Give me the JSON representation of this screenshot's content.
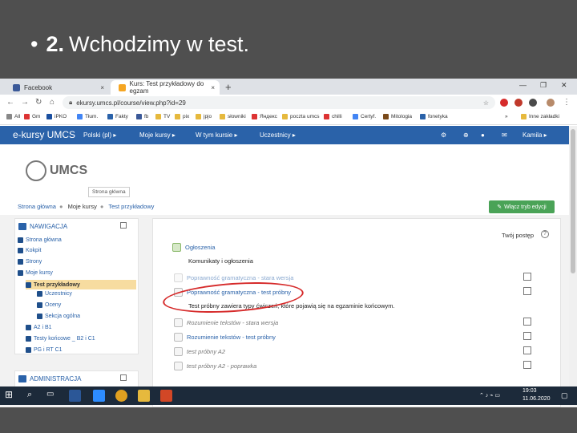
{
  "slide": {
    "bullet": "•",
    "number": "2.",
    "title": "Wchodzimy w test."
  },
  "browser": {
    "tabs": [
      {
        "label": "Facebook",
        "favicon_color": "#3b5998"
      },
      {
        "label": "Kurs: Test przykładowy do egzam",
        "favicon_color": "#f5a623"
      }
    ],
    "new_tab": "+",
    "close": "×",
    "address": "ekursy.umcs.pl/course/view.php?id=29",
    "bookmarks": [
      {
        "label": "All",
        "color": "#888"
      },
      {
        "label": "Gm",
        "color": "#d33"
      },
      {
        "label": "iPKO",
        "color": "#1a4fa0"
      },
      {
        "label": "Tłum.",
        "color": "#4285f4"
      },
      {
        "label": "Fakty",
        "color": "#2a62a9"
      },
      {
        "label": "fb",
        "color": "#3b5998"
      },
      {
        "label": "TV",
        "color": "#e6b93d"
      },
      {
        "label": "pix",
        "color": "#e6b93d"
      },
      {
        "label": "jpjo",
        "color": "#e6b93d"
      },
      {
        "label": "słowniki",
        "color": "#e6b93d"
      },
      {
        "label": "Яндекс",
        "color": "#d33"
      },
      {
        "label": "poczta umcs",
        "color": "#e6b93d"
      },
      {
        "label": "chilli",
        "color": "#d33"
      },
      {
        "label": "Certyf.",
        "color": "#4285f4"
      },
      {
        "label": "Mitologia",
        "color": "#7a4a1a"
      },
      {
        "label": "fonetyka",
        "color": "#2a62a9"
      },
      {
        "label": "»",
        "color": "#fff"
      },
      {
        "label": "Inne zakładki",
        "color": "#e6b93d"
      }
    ]
  },
  "moodle": {
    "brand": "e-kursy UMCS",
    "menu": [
      "Polski (pl) ▸",
      "Moje kursy ▸",
      "W tym kursie ▸",
      "Uczestnicy ▸"
    ],
    "user": "Kamila ▸",
    "logo_text": "UMCS",
    "tooltip": "Strona główna",
    "breadcrumb": [
      "Strona główna",
      "Moje kursy",
      "Test przykładowy"
    ],
    "edit_button": "Włącz tryb edycji",
    "nav_block_title": "NAWIGACJA",
    "nav_items": [
      "Strona główna",
      "Kokpit",
      "Strony",
      "Moje kursy",
      "Test przykładowy",
      "Uczestnicy",
      "Oceny",
      "Sekcja ogólna",
      "A2 i B1",
      "Testy końcowe _ B2 i C1",
      "PG i RT C1"
    ],
    "admin_block_title": "ADMINISTRACJA",
    "progress_label": "Twój postęp",
    "help": "?",
    "activities": {
      "announcements": "Ogłoszenia",
      "announcements_desc": "Komunikaty i ogłoszenia",
      "items": [
        "Poprawność gramatyczna - stara wersja",
        "Poprawność gramatyczna - test próbny",
        "Rozumienie tekstów - stara wersja",
        "Rozumienie tekstów - test próbny",
        "test próbny A2",
        "test próbny A2 - poprawka"
      ],
      "test_desc": "Test próbny zawiera typy ćwiczeń, które pojawią się na egzaminie końcowym."
    }
  },
  "taskbar": {
    "time": "19:03",
    "date": "11.06.2020"
  },
  "colors": {
    "moodle_blue": "#2a62a9",
    "edit_green": "#4aa357",
    "highlight_ring": "#d62b2b"
  }
}
